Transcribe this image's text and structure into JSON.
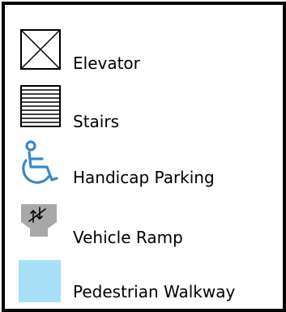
{
  "legend": {
    "items": [
      {
        "label": "Elevator",
        "icon": "elevator-icon"
      },
      {
        "label": "Stairs",
        "icon": "stairs-icon"
      },
      {
        "label": "Handicap Parking",
        "icon": "handicap-parking-icon"
      },
      {
        "label": "Vehicle Ramp",
        "icon": "vehicle-ramp-icon"
      },
      {
        "label": "Pedestrian Walkway",
        "icon": "pedestrian-walkway-swatch"
      }
    ]
  },
  "colors": {
    "frame": "#000000",
    "handicap_icon": "#3a88c8",
    "ramp_icon": "#a8a8a8",
    "walkway_swatch": "#a8e0f7"
  }
}
